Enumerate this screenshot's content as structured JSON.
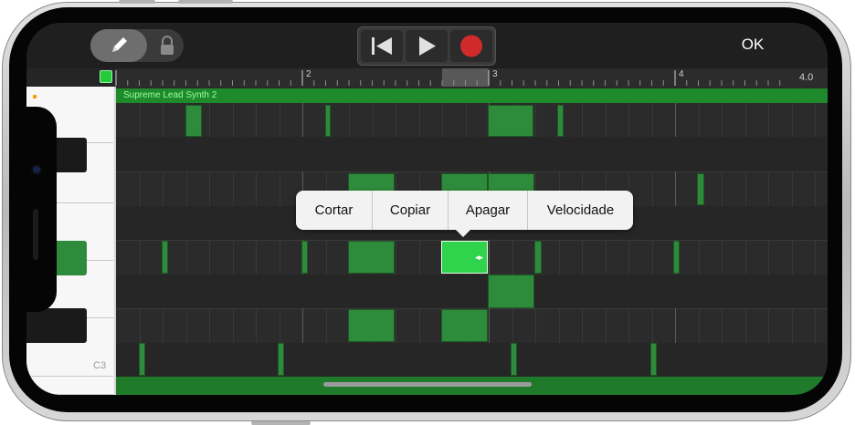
{
  "toolbar": {
    "edit_icon": "pencil-icon",
    "lock_icon": "lock-icon",
    "transport": {
      "rewind_icon": "skip-to-start-icon",
      "play_icon": "play-icon",
      "record_icon": "record-icon"
    },
    "ok_label": "OK"
  },
  "ruler": {
    "bar_2": "2",
    "bar_3": "3",
    "bar_4": "4",
    "end_value": "4.0"
  },
  "region": {
    "name": "Supreme Lead Synth 2"
  },
  "keyboard": {
    "c3_label": "C3"
  },
  "edit_menu": {
    "items": [
      {
        "label": "Cortar"
      },
      {
        "label": "Copiar"
      },
      {
        "label": "Apagar"
      },
      {
        "label": "Velocidade"
      }
    ]
  },
  "colors": {
    "note": "#2f8b3c",
    "note_selected": "#2fd44c",
    "region": "#1f8a2b",
    "record": "#d02a2a"
  }
}
